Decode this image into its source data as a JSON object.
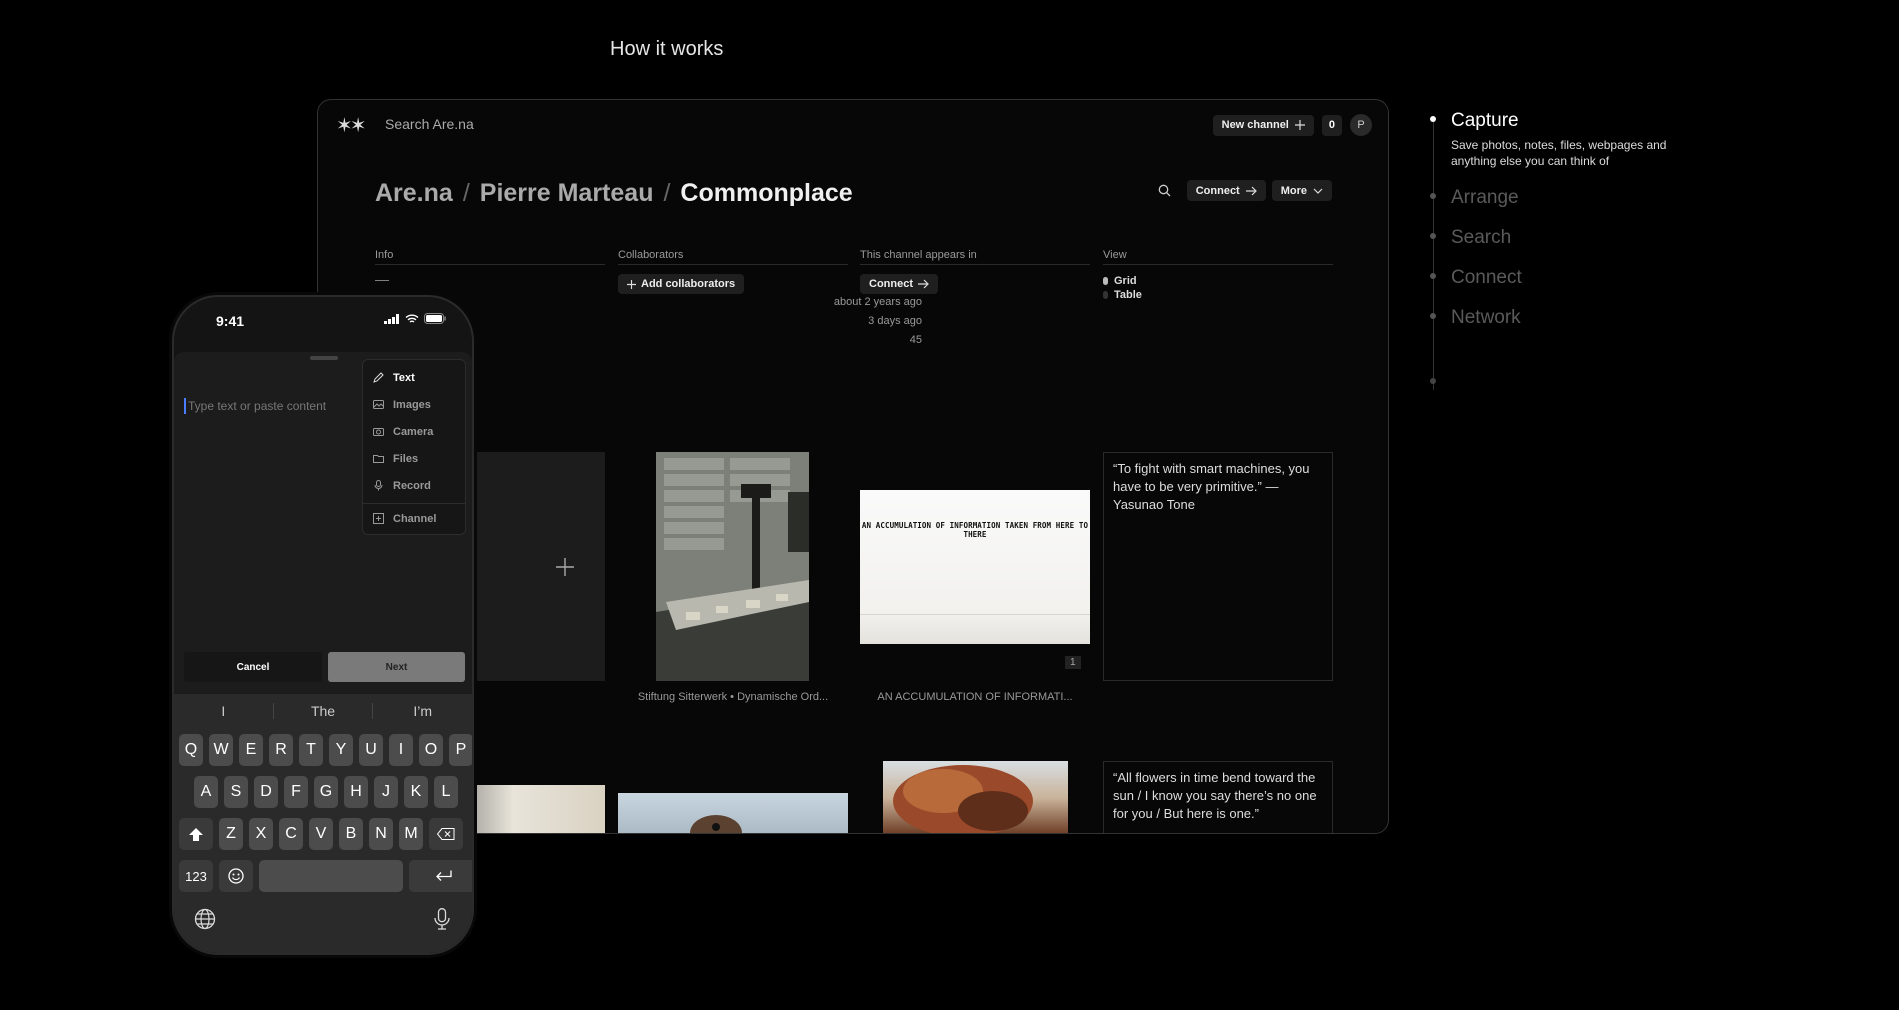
{
  "heading": "How it works",
  "desktop": {
    "search_placeholder": "Search Are.na",
    "new_channel_label": "New channel",
    "notification_count": "0",
    "avatar_initial": "P",
    "breadcrumb": [
      "Are.na",
      "Pierre Marteau",
      "Commonplace"
    ],
    "connect_label": "Connect",
    "more_label": "More",
    "columns": {
      "info": "Info",
      "collaborators": "Collaborators",
      "appears_in": "This channel appears in",
      "view": "View"
    },
    "info_dash": "—",
    "info_values": [
      "about 2 years ago",
      "3 days ago",
      "45"
    ],
    "add_collaborators_label": "Add collaborators",
    "appears_connect_label": "Connect",
    "view_options": [
      "Grid",
      "Table"
    ],
    "blocks": {
      "photo_caption": "Stiftung Sitterwerk • Dynamische Ord...",
      "text_image": "AN ACCUMULATION OF INFORMATION TAKEN FROM HERE TO THERE",
      "text_caption": "AN ACCUMULATION OF INFORMATI...",
      "text_badge": "1",
      "quote1": "“To fight with smart machines, you have to be very primitive.” —Yasunao Tone",
      "quote2": "“All flowers in time bend toward the sun / I know you say there’s no one for you / But here is one.”"
    }
  },
  "steps": [
    {
      "title": "Capture",
      "desc": "Save photos, notes, files, webpages and anything else you can think of",
      "active": true
    },
    {
      "title": "Arrange"
    },
    {
      "title": "Search"
    },
    {
      "title": "Connect"
    },
    {
      "title": "Network"
    }
  ],
  "phone": {
    "time": "9:41",
    "input_placeholder": "Type text or paste content",
    "menu": [
      "Text",
      "Images",
      "Camera",
      "Files",
      "Record",
      "Channel"
    ],
    "cancel_label": "Cancel",
    "next_label": "Next",
    "suggestions": [
      "I",
      "The",
      "I’m"
    ],
    "rows": [
      [
        "Q",
        "W",
        "E",
        "R",
        "T",
        "Y",
        "U",
        "I",
        "O",
        "P"
      ],
      [
        "A",
        "S",
        "D",
        "F",
        "G",
        "H",
        "J",
        "K",
        "L"
      ],
      [
        "Z",
        "X",
        "C",
        "V",
        "B",
        "N",
        "M"
      ]
    ],
    "numbers_key": "123"
  },
  "colors": {
    "background": "#000000",
    "accent_cursor": "#4a7dff"
  }
}
